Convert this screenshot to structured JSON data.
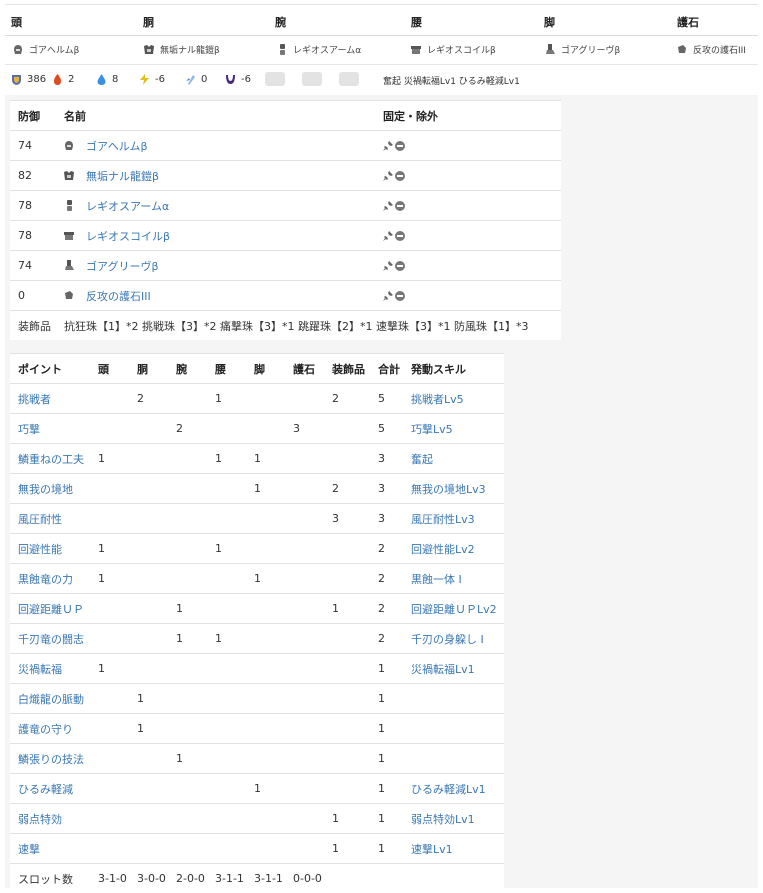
{
  "header": {
    "columns": [
      "頭",
      "胴",
      "腕",
      "腰",
      "脚",
      "護石"
    ]
  },
  "equipment": [
    {
      "slot": "head",
      "name": "ゴアヘルムβ",
      "icon": "helmet-icon"
    },
    {
      "slot": "body",
      "name": "無垢ナル龍鎧β",
      "icon": "chest-icon"
    },
    {
      "slot": "arms",
      "name": "レギオスアームα",
      "icon": "arm-icon"
    },
    {
      "slot": "waist",
      "name": "レギオスコイルβ",
      "icon": "waist-icon"
    },
    {
      "slot": "legs",
      "name": "ゴアグリーヴβ",
      "icon": "leg-icon"
    },
    {
      "slot": "charm",
      "name": "反攻の護石III",
      "icon": "charm-icon"
    }
  ],
  "stats": {
    "defense": "386",
    "fire": "2",
    "water": "8",
    "thunder": "-6",
    "ice": "0",
    "dragon": "-6",
    "active_skills": "奮起 災禍転福Lv1 ひるみ軽減Lv1"
  },
  "armor_table": {
    "headers": {
      "defense": "防御",
      "name": "名前",
      "lock": "固定・除外"
    },
    "rows": [
      {
        "defense": "74",
        "name": "ゴアヘルムβ",
        "icon": "helmet-icon"
      },
      {
        "defense": "82",
        "name": "無垢ナル龍鎧β",
        "icon": "chest-icon"
      },
      {
        "defense": "78",
        "name": "レギオスアームα",
        "icon": "arm-icon"
      },
      {
        "defense": "78",
        "name": "レギオスコイルβ",
        "icon": "waist-icon"
      },
      {
        "defense": "74",
        "name": "ゴアグリーヴβ",
        "icon": "leg-icon"
      },
      {
        "defense": "0",
        "name": "反攻の護石III",
        "icon": "charm-icon"
      }
    ],
    "decoration_label": "装飾品",
    "decoration_value": "抗狂珠【1】*2 挑戦珠【3】*2 痛撃珠【3】*1 跳躍珠【2】*1 速撃珠【3】*1 防風珠【1】*3"
  },
  "skill_table": {
    "headers": {
      "point": "ポイント",
      "head": "頭",
      "body": "胴",
      "arms": "腕",
      "waist": "腰",
      "legs": "脚",
      "charm": "護石",
      "deco": "装飾品",
      "total": "合計",
      "skill": "発動スキル"
    },
    "rows": [
      {
        "point": "挑戦者",
        "head": "",
        "body": "2",
        "arms": "",
        "waist": "1",
        "legs": "",
        "charm": "",
        "deco": "2",
        "total": "5",
        "skill": "挑戦者Lv5"
      },
      {
        "point": "巧撃",
        "head": "",
        "body": "",
        "arms": "2",
        "waist": "",
        "legs": "",
        "charm": "3",
        "deco": "",
        "total": "5",
        "skill": "巧撃Lv5"
      },
      {
        "point": "鱗重ねの工夫",
        "head": "1",
        "body": "",
        "arms": "",
        "waist": "1",
        "legs": "1",
        "charm": "",
        "deco": "",
        "total": "3",
        "skill": "奮起"
      },
      {
        "point": "無我の境地",
        "head": "",
        "body": "",
        "arms": "",
        "waist": "",
        "legs": "1",
        "charm": "",
        "deco": "2",
        "total": "3",
        "skill": "無我の境地Lv3"
      },
      {
        "point": "風圧耐性",
        "head": "",
        "body": "",
        "arms": "",
        "waist": "",
        "legs": "",
        "charm": "",
        "deco": "3",
        "total": "3",
        "skill": "風圧耐性Lv3"
      },
      {
        "point": "回避性能",
        "head": "1",
        "body": "",
        "arms": "",
        "waist": "1",
        "legs": "",
        "charm": "",
        "deco": "",
        "total": "2",
        "skill": "回避性能Lv2"
      },
      {
        "point": "黒蝕竜の力",
        "head": "1",
        "body": "",
        "arms": "",
        "waist": "",
        "legs": "1",
        "charm": "",
        "deco": "",
        "total": "2",
        "skill": "黒蝕一体 I"
      },
      {
        "point": "回避距離ＵＰ",
        "head": "",
        "body": "",
        "arms": "1",
        "waist": "",
        "legs": "",
        "charm": "",
        "deco": "1",
        "total": "2",
        "skill": "回避距離ＵＰLv2"
      },
      {
        "point": "千刃竜の闘志",
        "head": "",
        "body": "",
        "arms": "1",
        "waist": "1",
        "legs": "",
        "charm": "",
        "deco": "",
        "total": "2",
        "skill": "千刃の身躱し I"
      },
      {
        "point": "災禍転福",
        "head": "1",
        "body": "",
        "arms": "",
        "waist": "",
        "legs": "",
        "charm": "",
        "deco": "",
        "total": "1",
        "skill": "災禍転福Lv1"
      },
      {
        "point": "白熾龍の脈動",
        "head": "",
        "body": "1",
        "arms": "",
        "waist": "",
        "legs": "",
        "charm": "",
        "deco": "",
        "total": "1",
        "skill": ""
      },
      {
        "point": "護竜の守り",
        "head": "",
        "body": "1",
        "arms": "",
        "waist": "",
        "legs": "",
        "charm": "",
        "deco": "",
        "total": "1",
        "skill": ""
      },
      {
        "point": "鱗張りの技法",
        "head": "",
        "body": "",
        "arms": "1",
        "waist": "",
        "legs": "",
        "charm": "",
        "deco": "",
        "total": "1",
        "skill": ""
      },
      {
        "point": "ひるみ軽減",
        "head": "",
        "body": "",
        "arms": "",
        "waist": "",
        "legs": "1",
        "charm": "",
        "deco": "",
        "total": "1",
        "skill": "ひるみ軽減Lv1"
      },
      {
        "point": "弱点特効",
        "head": "",
        "body": "",
        "arms": "",
        "waist": "",
        "legs": "",
        "charm": "",
        "deco": "1",
        "total": "1",
        "skill": "弱点特効Lv1"
      },
      {
        "point": "速撃",
        "head": "",
        "body": "",
        "arms": "",
        "waist": "",
        "legs": "",
        "charm": "",
        "deco": "1",
        "total": "1",
        "skill": "速撃Lv1"
      }
    ],
    "slots": {
      "label": "スロット数",
      "head": "3-1-0",
      "body": "3-0-0",
      "arms": "2-0-0",
      "waist": "3-1-1",
      "legs": "3-1-1",
      "charm": "0-0-0"
    }
  },
  "colors": {
    "link": "#3a78b5",
    "background_band": "#f5f5f5",
    "border": "#e2e2e2"
  }
}
